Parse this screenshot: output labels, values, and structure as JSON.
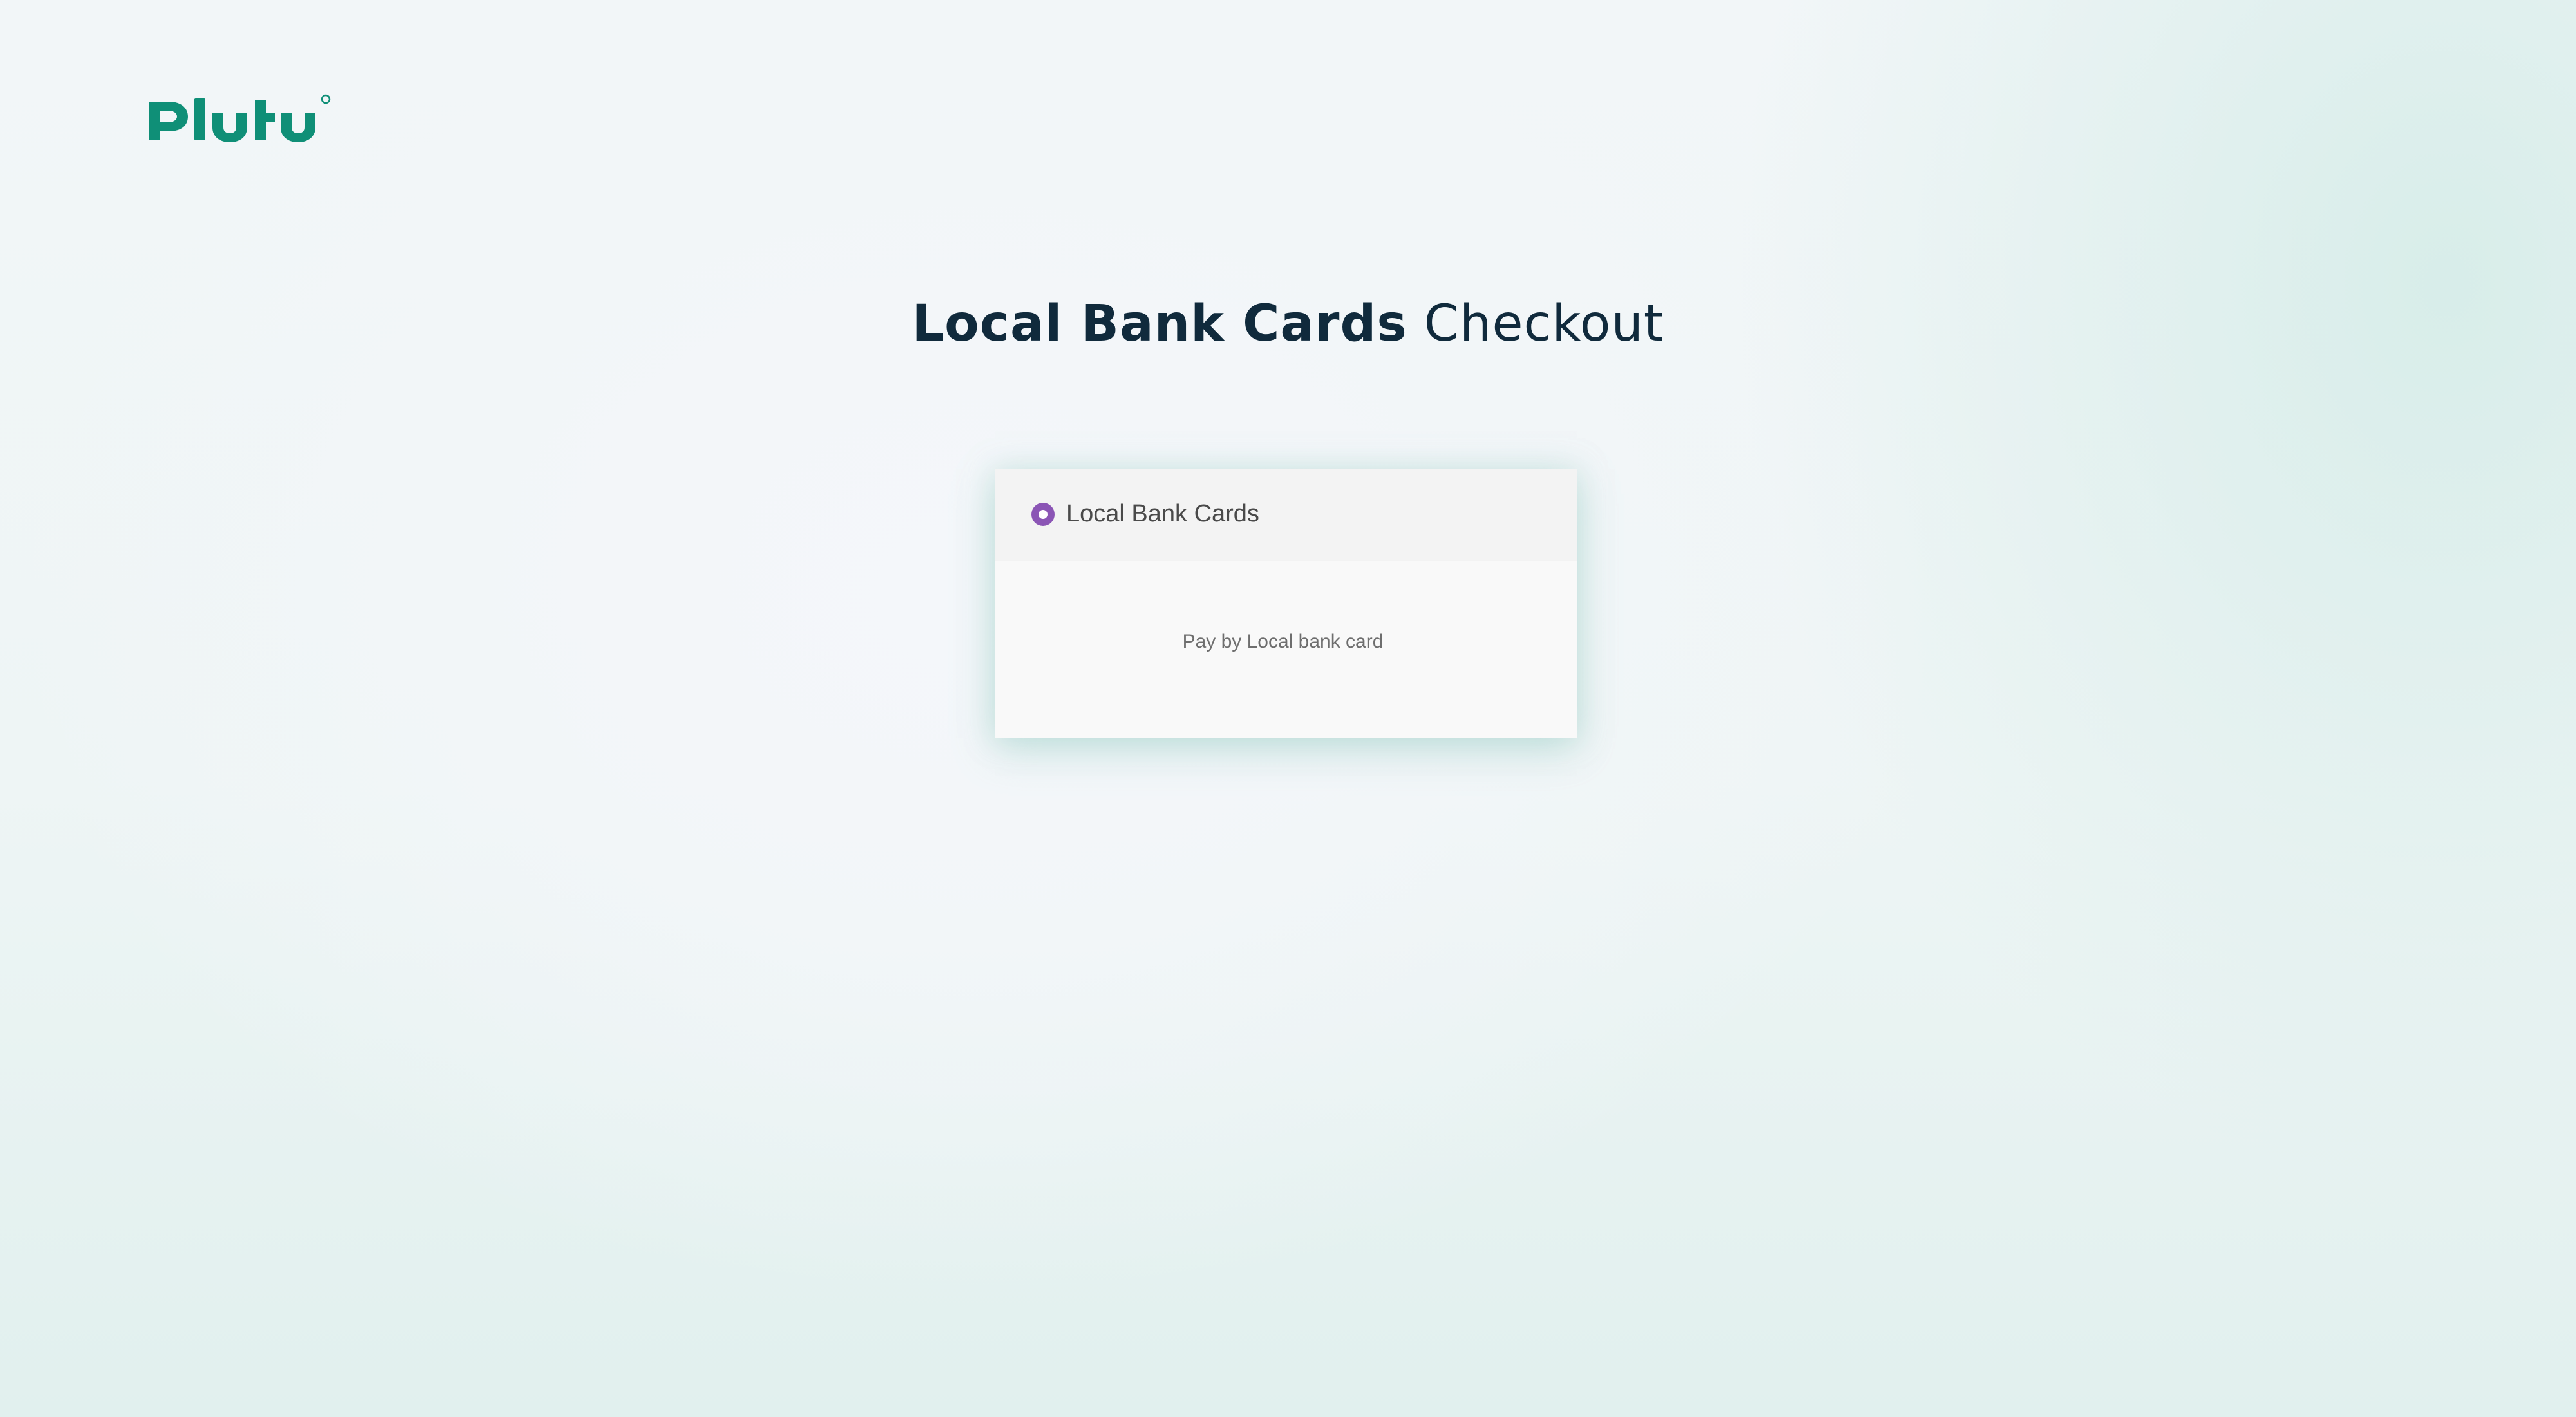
{
  "brand": {
    "name": "Plutu",
    "logo_icon": "plutu-logo",
    "color": "#0f8f77"
  },
  "page": {
    "title_strong": "Local Bank Cards",
    "title_light": "Checkout"
  },
  "payment_method": {
    "label": "Local Bank Cards",
    "description": "Pay by Local bank card",
    "selected": true,
    "radio_color": "#8b55b5"
  }
}
